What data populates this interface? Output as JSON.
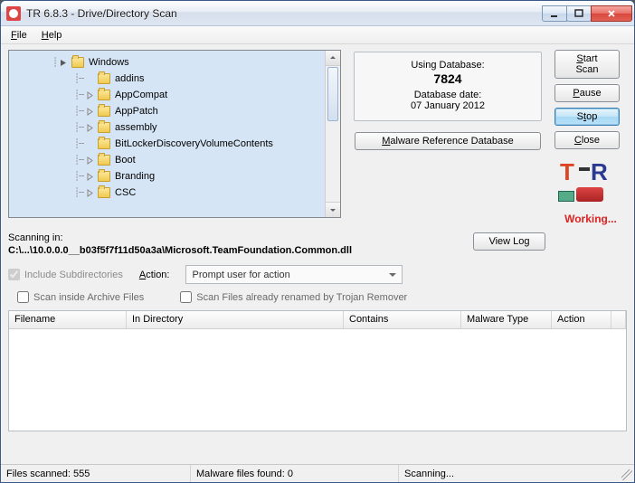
{
  "window": {
    "title": "TR 6.8.3  -  Drive/Directory Scan"
  },
  "menu": {
    "file": "File",
    "help": "Help"
  },
  "tree": {
    "root": "Windows",
    "children": [
      "addins",
      "AppCompat",
      "AppPatch",
      "assembly",
      "BitLockerDiscoveryVolumeContents",
      "Boot",
      "Branding",
      "CSC"
    ]
  },
  "db": {
    "using": "Using Database:",
    "count": "7824",
    "date_lbl": "Database date:",
    "date": "07 January 2012"
  },
  "buttons": {
    "malref": "Malware Reference Database",
    "start": "Start Scan",
    "pause": "Pause",
    "stop": "Stop",
    "close": "Close",
    "viewlog": "View Log"
  },
  "working": "Working...",
  "scan": {
    "label": "Scanning in:",
    "path": "C:\\...\\10.0.0.0__b03f5f7f11d50a3a\\Microsoft.TeamFoundation.Common.dll"
  },
  "options": {
    "include_sub": "Include Subdirectories",
    "action_lbl": "Action:",
    "action_val": "Prompt user for action",
    "scan_archive": "Scan inside Archive Files",
    "scan_renamed": "Scan Files already renamed by Trojan Remover"
  },
  "columns": {
    "filename": "Filename",
    "indir": "In Directory",
    "contains": "Contains",
    "maltype": "Malware Type",
    "action": "Action"
  },
  "status": {
    "scanned": "Files scanned: 555",
    "found": "Malware files found: 0",
    "state": "Scanning..."
  }
}
